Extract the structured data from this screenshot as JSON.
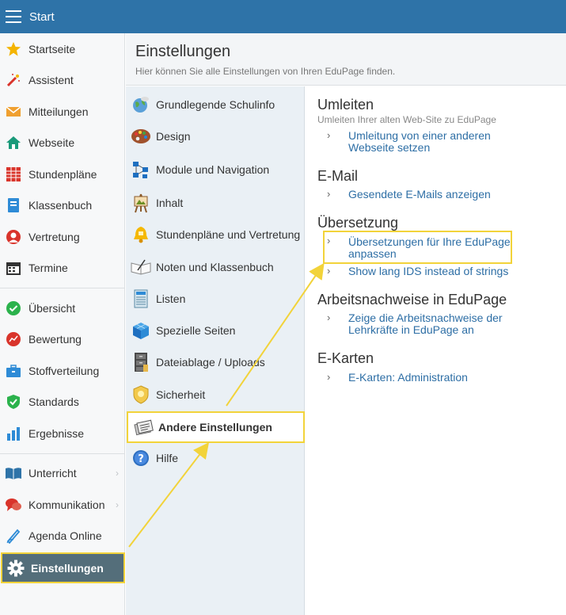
{
  "topbar": {
    "title": "Start"
  },
  "sidebar": {
    "items": [
      {
        "label": "Startseite",
        "icon": "star-icon",
        "color": "#f4b400"
      },
      {
        "label": "Assistent",
        "icon": "magic-wand-icon",
        "color": "#d9342b"
      },
      {
        "label": "Mitteilungen",
        "icon": "envelope-icon",
        "color": "#f0a030"
      },
      {
        "label": "Webseite",
        "icon": "home-icon",
        "color": "#1a9a7a"
      },
      {
        "label": "Stundenpläne",
        "icon": "timetable-icon",
        "color": "#d9342b"
      },
      {
        "label": "Klassenbuch",
        "icon": "book-icon",
        "color": "#2e8bd6"
      },
      {
        "label": "Vertretung",
        "icon": "person-icon",
        "color": "#d9342b"
      },
      {
        "label": "Termine",
        "icon": "calendar-icon",
        "color": "#333333"
      },
      {
        "label": "Übersicht",
        "icon": "check-circle-icon",
        "color": "#2bb24c"
      },
      {
        "label": "Bewertung",
        "icon": "chart-circle-icon",
        "color": "#d9342b"
      },
      {
        "label": "Stoffverteilung",
        "icon": "briefcase-icon",
        "color": "#2e8bd6"
      },
      {
        "label": "Standards",
        "icon": "shield-check-icon",
        "color": "#2bb24c"
      },
      {
        "label": "Ergebnisse",
        "icon": "bar-chart-icon",
        "color": "#2e8bd6"
      },
      {
        "label": "Unterricht",
        "icon": "open-book-icon",
        "color": "#2e73a8"
      },
      {
        "label": "Kommunikation",
        "icon": "chat-icon",
        "color": "#d9342b"
      },
      {
        "label": "Agenda Online",
        "icon": "pen-icon",
        "color": "#2e8bd6"
      },
      {
        "label": "Einstellungen",
        "icon": "gear-icon",
        "color": "#ffffff"
      }
    ]
  },
  "header": {
    "title": "Einstellungen",
    "subtitle": "Hier können Sie alle Einstellungen von Ihren EduPage finden."
  },
  "midmenu": {
    "items": [
      {
        "label": "Grundlegende Schulinfo",
        "icon": "globe-icon"
      },
      {
        "label": "Design",
        "icon": "palette-icon"
      },
      {
        "label": "Module und Navigation",
        "icon": "network-icon"
      },
      {
        "label": "Inhalt",
        "icon": "easel-icon"
      },
      {
        "label": "Stundenpläne und Vertretung",
        "icon": "bell-icon"
      },
      {
        "label": "Noten und Klassenbuch",
        "icon": "notebook-pen-icon"
      },
      {
        "label": "Listen",
        "icon": "list-document-icon"
      },
      {
        "label": "Spezielle Seiten",
        "icon": "cube-icon"
      },
      {
        "label": "Dateiablage / Uploads",
        "icon": "file-cabinet-icon"
      },
      {
        "label": "Sicherheit",
        "icon": "security-badge-icon"
      },
      {
        "label": "Andere Einstellungen",
        "icon": "documents-icon"
      },
      {
        "label": "Hilfe",
        "icon": "help-icon"
      }
    ]
  },
  "content": {
    "sections": [
      {
        "title": "Umleiten",
        "subtitle": "Umleiten Ihrer alten Web-Site zu EduPage",
        "links": [
          "Umleitung von einer anderen Webseite setzen"
        ]
      },
      {
        "title": "E-Mail",
        "links": [
          "Gesendete E-Mails anzeigen"
        ]
      },
      {
        "title": "Übersetzung",
        "links": [
          "Übersetzungen für Ihre EduPage anpassen",
          "Show lang IDS instead of strings"
        ]
      },
      {
        "title": "Arbeitsnachweise in EduPage",
        "links": [
          "Zeige die Arbeitsnachweise der Lehrkräfte in EduPage an"
        ]
      },
      {
        "title": "E-Karten",
        "links": [
          "E-Karten: Administration"
        ]
      }
    ]
  },
  "colors": {
    "topbar": "#2e73a8",
    "link": "#2d6ea5",
    "highlight": "#f2d33a",
    "active_side": "#546e7a"
  }
}
